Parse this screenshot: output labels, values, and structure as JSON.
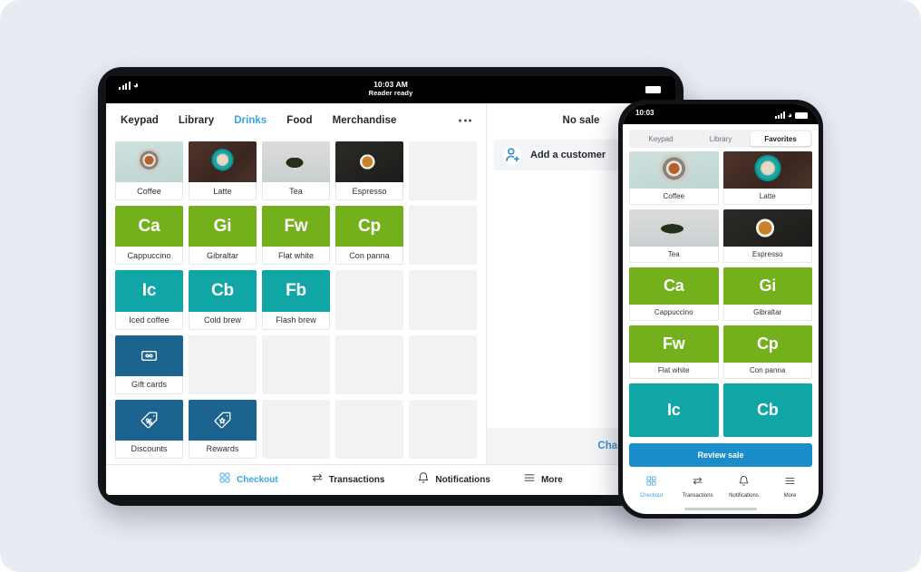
{
  "theme": {
    "background": "#e7ebf2",
    "green": "#73b01c",
    "teal": "#10a6a6",
    "dark_blue": "#1b6490",
    "accent_blue": "#3ba5e8",
    "button_blue": "#1c8dcb"
  },
  "tablet": {
    "status": {
      "time": "10:03 AM",
      "subtitle": "Reader ready",
      "wifi_icon": "wifi-icon",
      "signal_icon": "cellular-signal-icon",
      "battery_icon": "battery-icon"
    },
    "tabs": [
      {
        "label": "Keypad",
        "active": false
      },
      {
        "label": "Library",
        "active": false
      },
      {
        "label": "Drinks",
        "active": true
      },
      {
        "label": "Food",
        "active": false
      },
      {
        "label": "Merchandise",
        "active": false
      }
    ],
    "overflow_icon": "more-horizontal-icon",
    "grid": [
      {
        "label": "Coffee",
        "kind": "image",
        "image": "img-coffee"
      },
      {
        "label": "Latte",
        "kind": "image",
        "image": "img-latte"
      },
      {
        "label": "Tea",
        "kind": "image",
        "image": "img-tea"
      },
      {
        "label": "Espresso",
        "kind": "image",
        "image": "img-espresso"
      },
      {
        "kind": "empty"
      },
      {
        "label": "Cappuccino",
        "kind": "abbr",
        "abbr": "Ca",
        "color": "#73b01c"
      },
      {
        "label": "Gibraltar",
        "kind": "abbr",
        "abbr": "Gi",
        "color": "#73b01c"
      },
      {
        "label": "Flat white",
        "kind": "abbr",
        "abbr": "Fw",
        "color": "#73b01c"
      },
      {
        "label": "Con panna",
        "kind": "abbr",
        "abbr": "Cp",
        "color": "#73b01c"
      },
      {
        "kind": "empty"
      },
      {
        "label": "Iced coffee",
        "kind": "abbr",
        "abbr": "Ic",
        "color": "#10a6a6"
      },
      {
        "label": "Cold brew",
        "kind": "abbr",
        "abbr": "Cb",
        "color": "#10a6a6"
      },
      {
        "label": "Flash brew",
        "kind": "abbr",
        "abbr": "Fb",
        "color": "#10a6a6"
      },
      {
        "kind": "empty"
      },
      {
        "kind": "empty"
      },
      {
        "label": "Gift cards",
        "kind": "icon",
        "icon": "gift-card-icon",
        "color": "#1b6490"
      },
      {
        "kind": "empty"
      },
      {
        "kind": "empty"
      },
      {
        "kind": "empty"
      },
      {
        "kind": "empty"
      },
      {
        "label": "Discounts",
        "kind": "icon",
        "icon": "discount-tag-icon",
        "color": "#1b6490"
      },
      {
        "label": "Rewards",
        "kind": "icon",
        "icon": "reward-star-tag-icon",
        "color": "#1b6490"
      },
      {
        "kind": "empty"
      },
      {
        "kind": "empty"
      },
      {
        "kind": "empty"
      }
    ],
    "sale": {
      "title": "No sale",
      "add_customer_label": "Add a customer",
      "add_customer_icon": "add-person-icon",
      "charge_label": "Charge $0.00"
    },
    "nav": [
      {
        "label": "Checkout",
        "icon": "grid-squares-icon",
        "active": true
      },
      {
        "label": "Transactions",
        "icon": "transfer-arrows-icon",
        "active": false
      },
      {
        "label": "Notifications",
        "icon": "bell-icon",
        "active": false
      },
      {
        "label": "More",
        "icon": "hamburger-icon",
        "active": false
      }
    ]
  },
  "phone": {
    "status": {
      "time": "10:03",
      "signal_icon": "cellular-signal-icon",
      "wifi_icon": "wifi-icon",
      "battery_icon": "battery-icon"
    },
    "tabs": [
      {
        "label": "Keypad",
        "active": false
      },
      {
        "label": "Library",
        "active": false
      },
      {
        "label": "Favorites",
        "active": true
      }
    ],
    "grid": [
      {
        "label": "Coffee",
        "kind": "image",
        "image": "img-coffee"
      },
      {
        "label": "Latte",
        "kind": "image",
        "image": "img-latte"
      },
      {
        "label": "Tea",
        "kind": "image",
        "image": "img-tea"
      },
      {
        "label": "Espresso",
        "kind": "image",
        "image": "img-espresso"
      },
      {
        "label": "Cappuccino",
        "kind": "abbr",
        "abbr": "Ca",
        "color": "#73b01c"
      },
      {
        "label": "Gibraltar",
        "kind": "abbr",
        "abbr": "Gi",
        "color": "#73b01c"
      },
      {
        "label": "Flat white",
        "kind": "abbr",
        "abbr": "Fw",
        "color": "#73b01c"
      },
      {
        "label": "Con panna",
        "kind": "abbr",
        "abbr": "Cp",
        "color": "#73b01c"
      },
      {
        "label": "",
        "kind": "abbr",
        "abbr": "Ic",
        "color": "#10a6a6"
      },
      {
        "label": "",
        "kind": "abbr",
        "abbr": "Cb",
        "color": "#10a6a6"
      }
    ],
    "review_sale_label": "Review sale",
    "nav": [
      {
        "label": "Checkout",
        "icon": "grid-squares-icon",
        "active": true
      },
      {
        "label": "Transactions",
        "icon": "transfer-arrows-icon",
        "active": false
      },
      {
        "label": "Notifications",
        "icon": "bell-icon",
        "active": false
      },
      {
        "label": "More",
        "icon": "hamburger-icon",
        "active": false
      }
    ]
  }
}
